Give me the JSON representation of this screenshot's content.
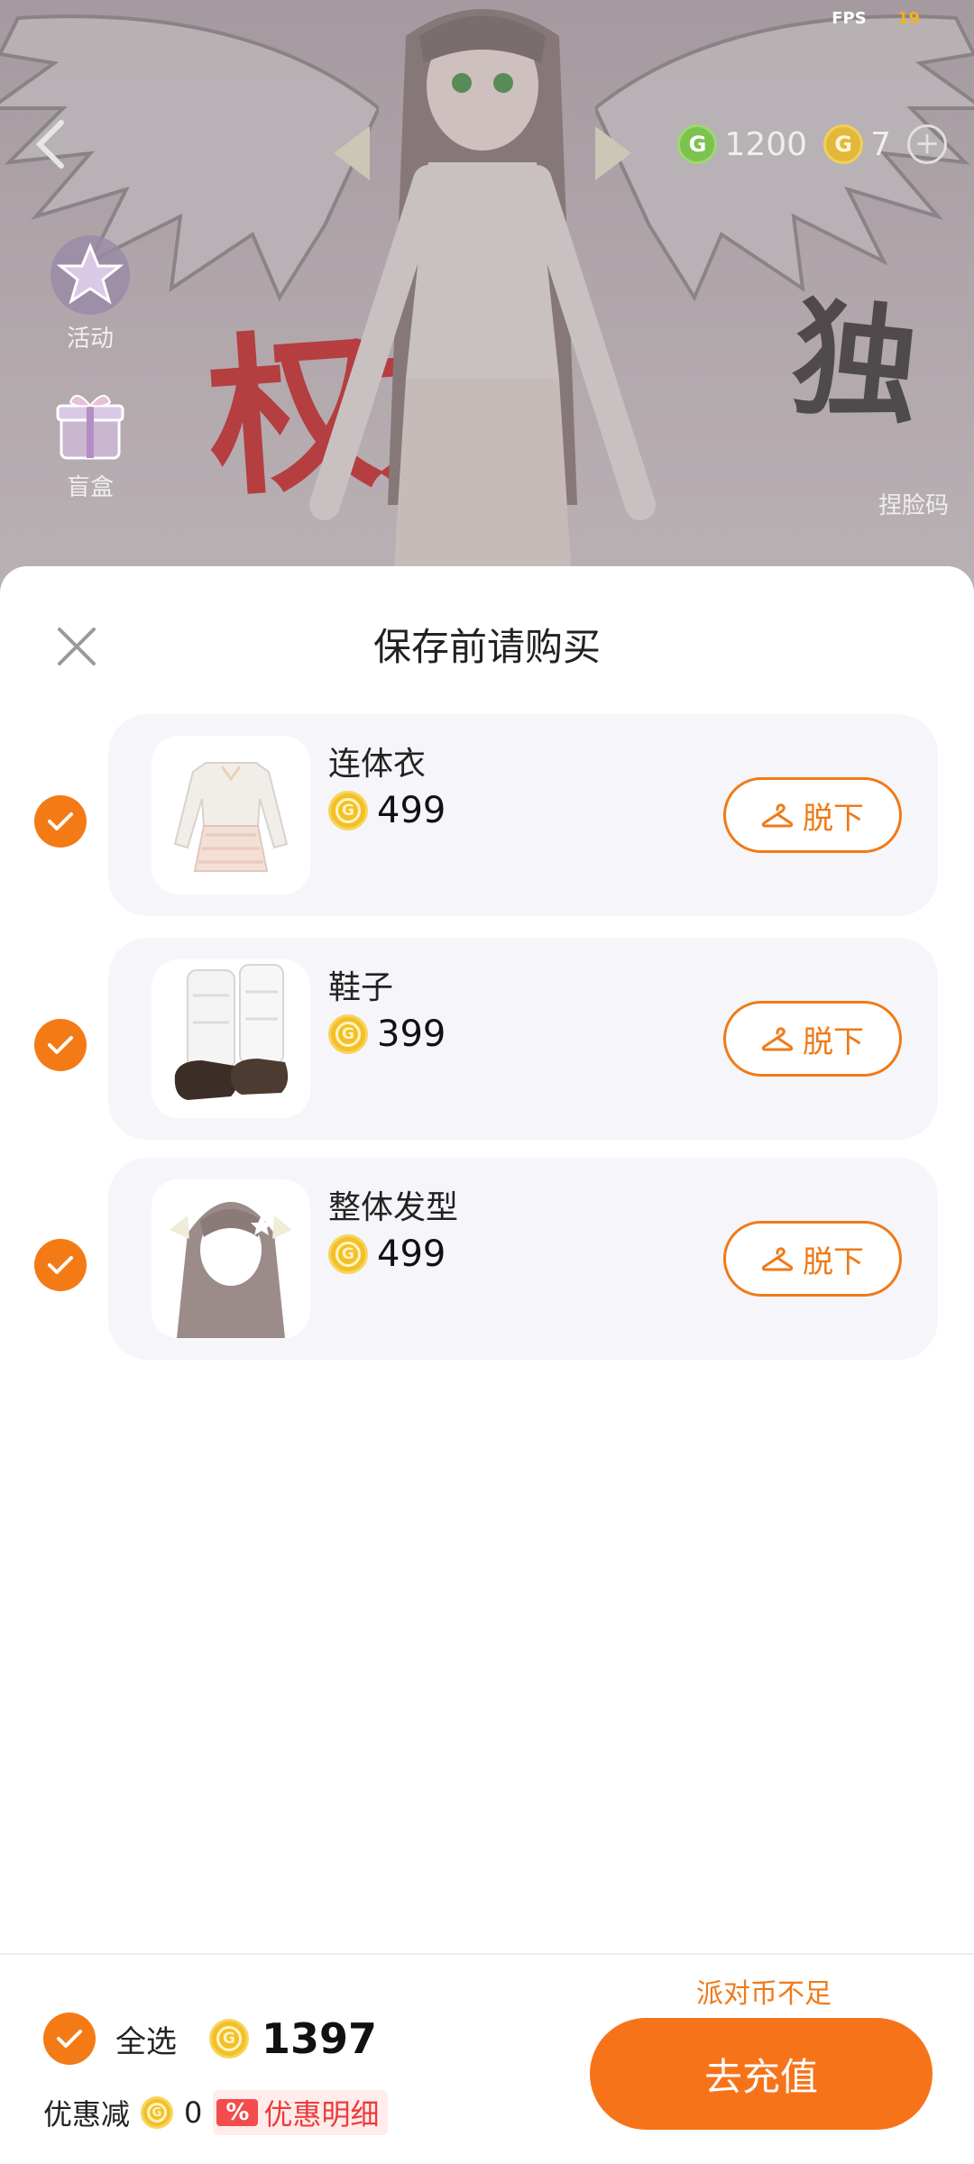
{
  "scene": {
    "fps_label": "FPS",
    "fps_value": "19",
    "currency_green": "1200",
    "currency_gold": "7",
    "side_menu": [
      {
        "label": "活动",
        "icon": "star-badge-icon"
      },
      {
        "label": "盲盒",
        "icon": "gift-box-icon"
      }
    ],
    "face_code_label": "捏脸码"
  },
  "sheet": {
    "title": "保存前请购买",
    "items": [
      {
        "name": "连体衣",
        "price": "499",
        "action": "脱下",
        "checked": true,
        "thumb": "dress-thumbnail"
      },
      {
        "name": "鞋子",
        "price": "399",
        "action": "脱下",
        "checked": true,
        "thumb": "shoes-thumbnail"
      },
      {
        "name": "整体发型",
        "price": "499",
        "action": "脱下",
        "checked": true,
        "thumb": "hairstyle-thumbnail"
      }
    ]
  },
  "bottom": {
    "select_all_label": "全选",
    "total": "1397",
    "discount_label": "优惠减",
    "discount_value": "0",
    "discount_detail_label": "优惠明细",
    "insufficient_text": "派对币不足",
    "recharge_label": "去充值"
  },
  "colors": {
    "accent": "#f7731a",
    "coin": "#f3c025",
    "card_bg": "#f6f6fa"
  }
}
